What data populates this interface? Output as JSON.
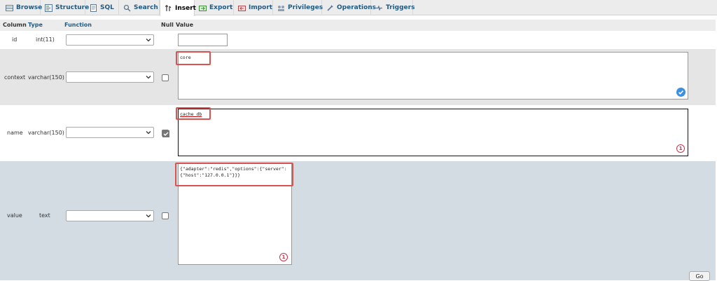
{
  "tabs": [
    {
      "label": "Browse",
      "icon": "browse-icon"
    },
    {
      "label": "Structure",
      "icon": "structure-icon"
    },
    {
      "label": "SQL",
      "icon": "sql-icon"
    },
    {
      "label": "Search",
      "icon": "search-icon"
    },
    {
      "label": "Insert",
      "icon": "insert-icon",
      "active": true
    },
    {
      "label": "Export",
      "icon": "export-icon"
    },
    {
      "label": "Import",
      "icon": "import-icon"
    },
    {
      "label": "Privileges",
      "icon": "privileges-icon"
    },
    {
      "label": "Operations",
      "icon": "operations-icon"
    },
    {
      "label": "Triggers",
      "icon": "triggers-icon"
    }
  ],
  "header": {
    "column": "Column",
    "type": "Type",
    "function": "Function",
    "null": "Null",
    "value": "Value"
  },
  "rows": [
    {
      "column": "id",
      "type": "int(11)",
      "value": "",
      "null_checked": false,
      "has_null": false
    },
    {
      "column": "context",
      "type": "varchar(150)",
      "value": "core",
      "null_checked": false,
      "has_null": true
    },
    {
      "column": "name",
      "type": "varchar(150)",
      "value": "cache_db",
      "null_checked": true,
      "has_null": true
    },
    {
      "column": "value",
      "type": "text",
      "value_line1": "{\"adapter\":\"redis\",\"options\":{\"server\":",
      "value_line2": "{\"host\":\"127.0.0.1\"}}}",
      "null_checked": false,
      "has_null": true
    }
  ],
  "badges": {
    "warn_count": "1"
  },
  "go_label": "Go",
  "colors": {
    "tab_text": "#235a81",
    "highlight": "#d9534f",
    "row_highlight": "#d3dce3",
    "row_alt": "#e5e5e5",
    "check_badge": "#3d8fe0",
    "warn_badge": "#c8334a"
  }
}
